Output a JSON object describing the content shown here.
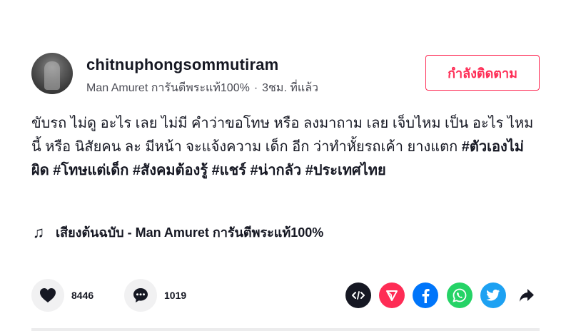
{
  "post": {
    "username": "chitnuphongsommutiram",
    "display_name": "Man Amuret การันตีพระแท้100%",
    "separator": "·",
    "time_ago": "3ชม. ที่แล้ว",
    "follow_label": "กำลังติดตาม",
    "caption_text": "ขับรถ ไม่ดู อะไร เลย ไม่มี คำว่าขอโทษ หรือ ลงมาถาม เลย เจ็บไหม เป็น อะไร ไหม นี้ หรือ นิสัยคน ละ มีหน้า จะแจ้งความ เด็ก อีก ว่าทำหั้ยรถเค้า ยางแตก",
    "hashtags": [
      "#ตัวเองไม่ผิด",
      "#โทษแต่เด็ก",
      "#สังคมต้องรู้",
      "#แชร์",
      "#น่ากลัว",
      "#ประเทศไทย"
    ],
    "music_icon": "♫",
    "music_title": "เสียงต้นฉบับ - Man Amuret การันตีพระแท้100%"
  },
  "actions": {
    "likes": "8446",
    "comments": "1019"
  },
  "share_icons": [
    "embed-icon",
    "send-icon",
    "facebook-icon",
    "whatsapp-icon",
    "twitter-icon",
    "share-arrow-icon"
  ],
  "colors": {
    "accent": "#fe2c55",
    "facebook": "#0075fa",
    "whatsapp": "#25d366",
    "twitter": "#1da1f2",
    "embed": "#161823",
    "send": "#fe2c55"
  }
}
